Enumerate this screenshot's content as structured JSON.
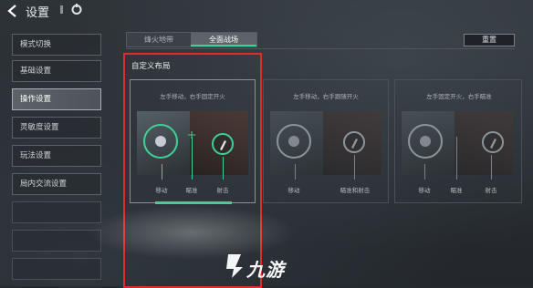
{
  "header": {
    "title": "设置"
  },
  "sidebar": {
    "items": [
      {
        "label": "模式切换"
      },
      {
        "label": "基础设置"
      },
      {
        "label": "操作设置"
      },
      {
        "label": "灵敏度设置"
      },
      {
        "label": "玩法设置"
      },
      {
        "label": "局内交流设置"
      }
    ],
    "active_index": 2
  },
  "mode_tabs": [
    {
      "label": "烽火地带"
    },
    {
      "label": "全面战场"
    }
  ],
  "reset_label": "重置",
  "section_title": "自定义布局",
  "cards": [
    {
      "caption": "左手移动，右手固定开火",
      "labels": [
        "移动",
        "瞄准",
        "射击"
      ]
    },
    {
      "caption": "左手移动，右手跟随开火",
      "labels": [
        "移动",
        "瞄准和射击"
      ]
    },
    {
      "caption": "左手固定开火，右手瞄准",
      "labels": [
        "移动",
        "瞄准",
        "射击"
      ]
    }
  ],
  "watermark": {
    "text": "九游"
  },
  "colors": {
    "accent": "#3fd09a",
    "highlight_frame": "#e12c2c"
  }
}
